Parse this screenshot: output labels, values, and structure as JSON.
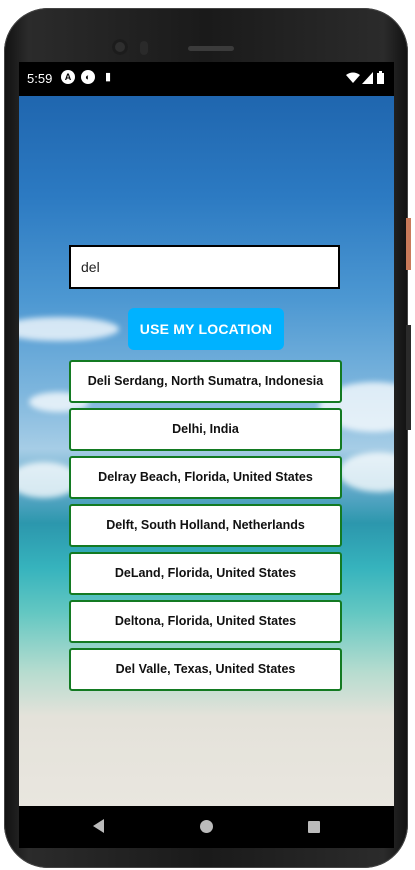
{
  "status_bar": {
    "time": "5:59",
    "left_icons": [
      "a-notification-icon",
      "app-notification-icon",
      "sd-card-icon"
    ],
    "right_icons": [
      "wifi-icon",
      "cell-signal-icon",
      "battery-icon"
    ]
  },
  "search": {
    "value": "del"
  },
  "location_button": {
    "label": "USE MY LOCATION"
  },
  "results": [
    "Deli Serdang, North Sumatra, Indonesia",
    "Delhi, India",
    "Delray Beach, Florida, United States",
    "Delft, South Holland, Netherlands",
    "DeLand, Florida, United States",
    "Deltona, Florida, United States",
    "Del Valle, Texas, United States"
  ],
  "nav_bar": {
    "icons": [
      "back-icon",
      "home-icon",
      "recents-icon"
    ]
  },
  "colors": {
    "accent_button": "#00b2ff",
    "result_border": "#137a22"
  }
}
